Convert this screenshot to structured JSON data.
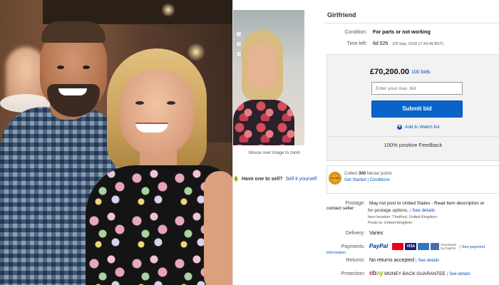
{
  "listing": {
    "title": "Girlfriend",
    "condition_label": "Condition:",
    "condition_value": "For parts or not working",
    "time_left_label": "Time left:",
    "time_left_value": "6d 02h",
    "time_left_detail": "(29 Sep, 2018  17:43:49 BST)",
    "price": "£70,200.00",
    "bids": "100 bids",
    "bid_placeholder": "Enter your max. bid",
    "submit_label": "Submit bid",
    "watch_label": "Add to Watch list",
    "feedback": "100% positive Feedback",
    "hover_hint": "Mouse over image to zoom",
    "sell_question": "Have one to sell?",
    "sell_link": "Sell it yourself"
  },
  "nectar": {
    "badge": "nectar",
    "line1_prefix": "Collect",
    "line1_points": "300",
    "line1_suffix": "Nectar points",
    "line2": "Get Started | Conditions"
  },
  "details": {
    "postage_label": "Postage:",
    "postage_value": "May not post to United States - Read item description or contact seller",
    "postage_value2": "for postage options.",
    "postage_link": "See details",
    "item_location": "Item location:  Thetford, United Kingdom",
    "posts_to": "Posts to:  United Kingdom",
    "delivery_label": "Delivery:",
    "delivery_value": "Varies",
    "payments_label": "Payments:",
    "paypal": "PayPal",
    "processed_by": "Processed by PayPal",
    "payment_link": "See payment information",
    "returns_label": "Returns:",
    "returns_value": "No returns accepted",
    "returns_link": "See details",
    "protection_label": "Protection:",
    "protection_value": "MONEY BACK GUARANTEE",
    "protection_link": "See details"
  },
  "icons": [
    "leaf-icon",
    "star-icon",
    "nectar-badge-icon",
    "mastercard-icon",
    "visa-icon",
    "amex-icon",
    "card-icon"
  ],
  "colors": {
    "link": "#0654ba",
    "submit": "#0a64c8",
    "paypal_blue": "#003087",
    "paypal_light": "#009cde"
  }
}
